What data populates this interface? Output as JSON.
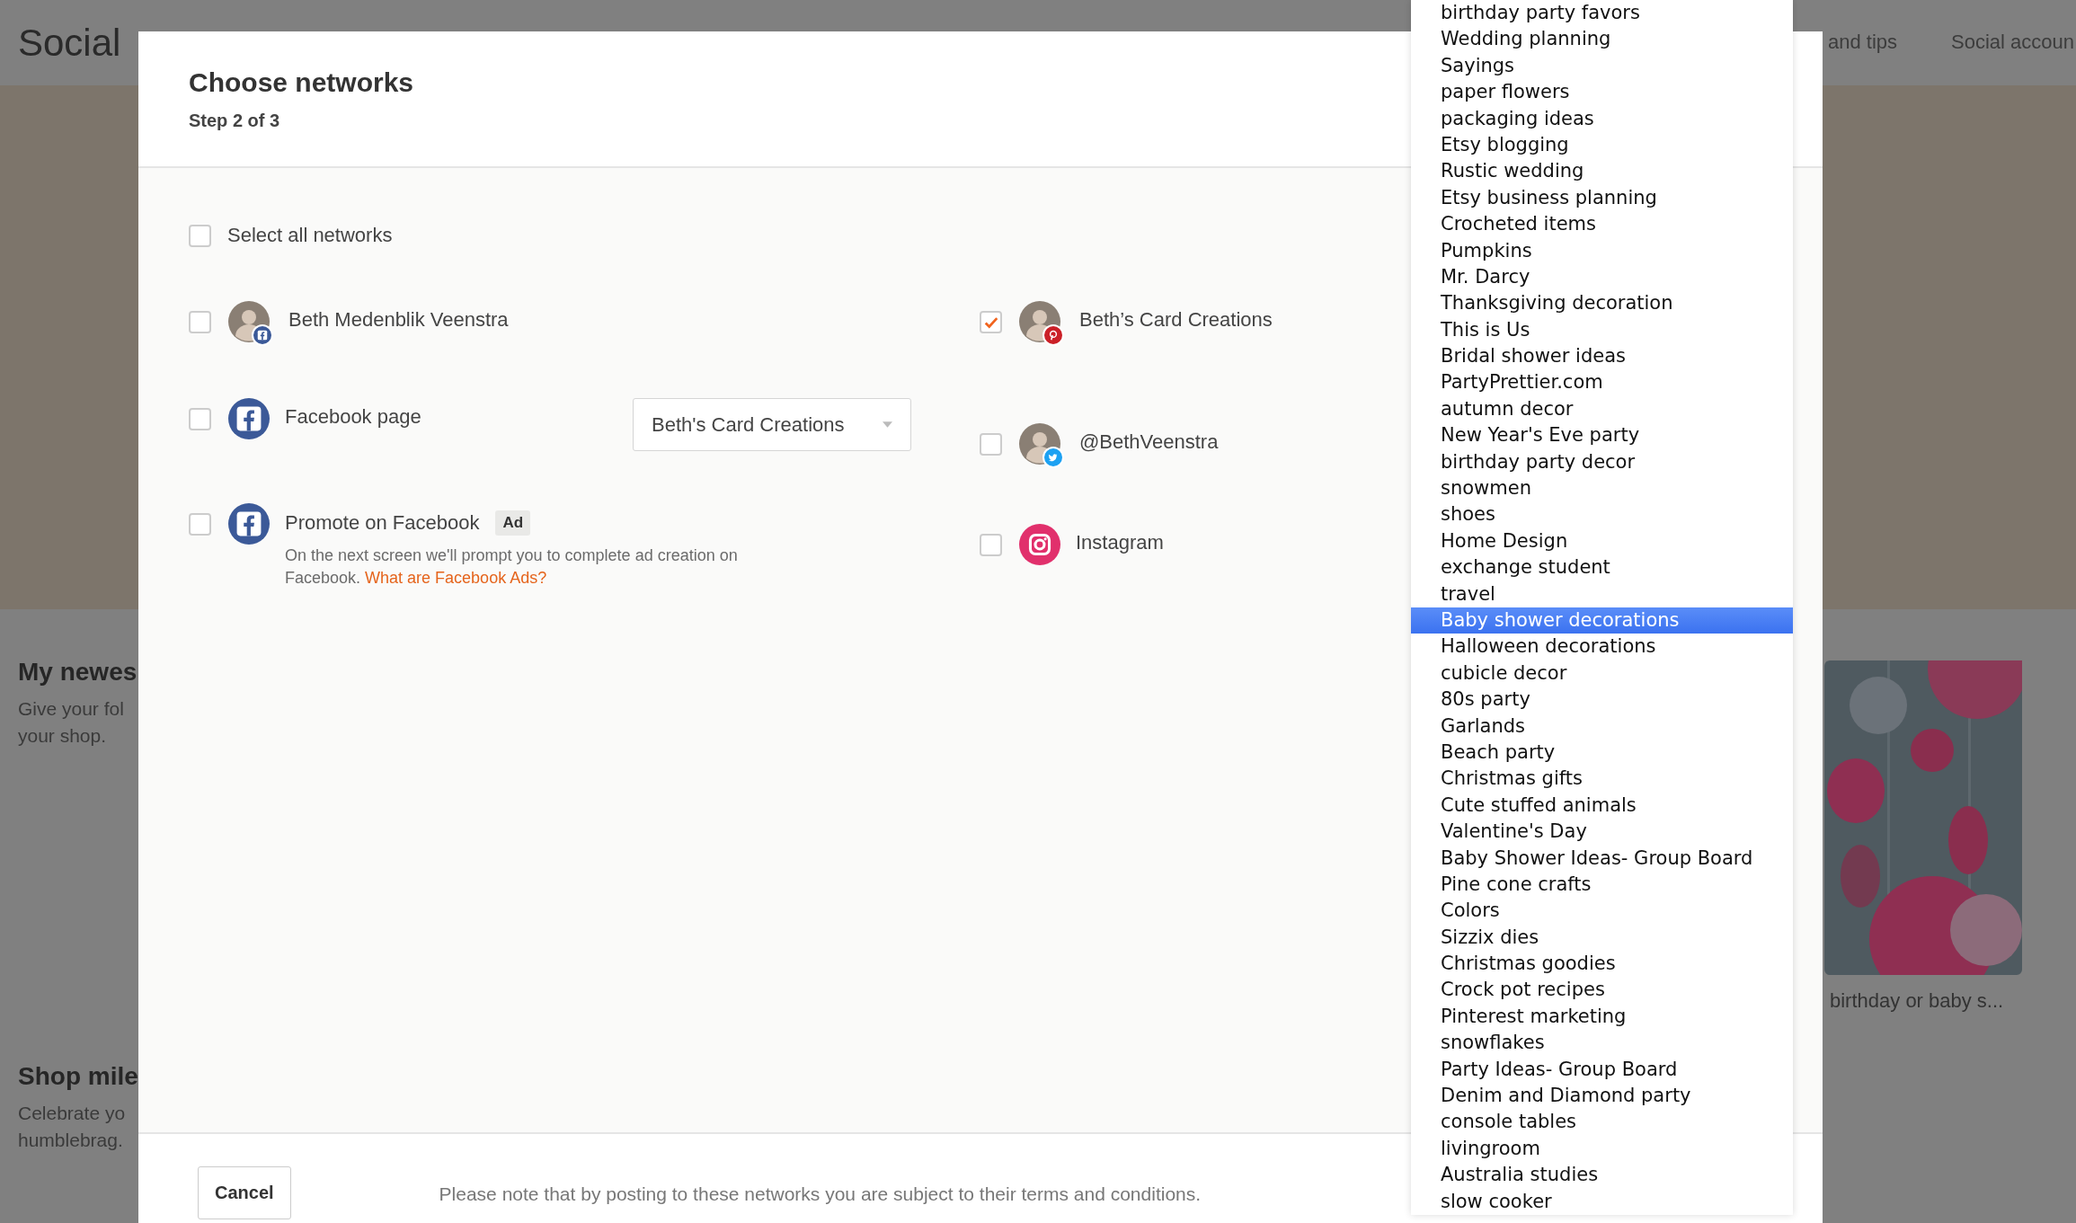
{
  "page": {
    "title": "Social",
    "nav": [
      {
        "label": "and tips"
      },
      {
        "label": "Social accoun"
      }
    ],
    "sections": [
      {
        "title": "My newes",
        "lines": [
          "Give your fol",
          "your shop."
        ]
      },
      {
        "title": "Shop mile",
        "lines": [
          "Celebrate yo",
          "humblebrag."
        ]
      }
    ],
    "card_caption": "birthday or baby s..."
  },
  "modal": {
    "title": "Choose networks",
    "step": "Step 2 of 3",
    "select_all": {
      "label": "Select all networks",
      "checked": false
    },
    "networks_left": [
      {
        "kind": "facebook",
        "avatar": true,
        "name": "Beth Medenblik Veenstra",
        "checked": false
      },
      {
        "kind": "facebook",
        "avatar": false,
        "name": "Facebook page",
        "checked": false,
        "dropdown": "Beth's Card Creations"
      },
      {
        "kind": "facebook",
        "avatar": false,
        "name": "Promote on Facebook",
        "checked": false,
        "badge": "Ad",
        "note": "On the next screen we'll prompt you to complete ad creation on Facebook.",
        "link": "What are Facebook Ads?"
      }
    ],
    "networks_right": [
      {
        "kind": "pinterest",
        "avatar": true,
        "name": "Beth’s Card Creations",
        "checked": true
      },
      {
        "kind": "twitter",
        "avatar": true,
        "name": "@BethVeenstra",
        "checked": false
      },
      {
        "kind": "instagram",
        "avatar": false,
        "name": "Instagram",
        "checked": false
      }
    ],
    "footer": {
      "cancel": "Cancel",
      "note": "Please note that by posting to these networks you are subject to their terms and conditions."
    }
  },
  "board_list": {
    "items": [
      {
        "label": "birthday party favors",
        "selected": false
      },
      {
        "label": "Wedding planning",
        "selected": false
      },
      {
        "label": "Sayings",
        "selected": false
      },
      {
        "label": "paper flowers",
        "selected": false
      },
      {
        "label": "packaging ideas",
        "selected": false
      },
      {
        "label": "Etsy blogging",
        "selected": false
      },
      {
        "label": "Rustic wedding",
        "selected": false
      },
      {
        "label": "Etsy business planning",
        "selected": false
      },
      {
        "label": "Crocheted items",
        "selected": false
      },
      {
        "label": "Pumpkins",
        "selected": false
      },
      {
        "label": "Mr. Darcy",
        "selected": false
      },
      {
        "label": "Thanksgiving decoration",
        "selected": false
      },
      {
        "label": "This is Us",
        "selected": false
      },
      {
        "label": "Bridal shower ideas",
        "selected": false
      },
      {
        "label": "PartyPrettier.com",
        "selected": false
      },
      {
        "label": "autumn decor",
        "selected": false
      },
      {
        "label": "New Year's Eve party",
        "selected": false
      },
      {
        "label": "birthday party decor",
        "selected": false
      },
      {
        "label": "snowmen",
        "selected": false
      },
      {
        "label": "shoes",
        "selected": false
      },
      {
        "label": "Home Design",
        "selected": false
      },
      {
        "label": "exchange student",
        "selected": false
      },
      {
        "label": "travel",
        "selected": false
      },
      {
        "label": "Baby shower decorations",
        "selected": true
      },
      {
        "label": "Halloween decorations",
        "selected": false
      },
      {
        "label": "cubicle decor",
        "selected": false
      },
      {
        "label": "80s party",
        "selected": false
      },
      {
        "label": "Garlands",
        "selected": false
      },
      {
        "label": "Beach party",
        "selected": false
      },
      {
        "label": "Christmas gifts",
        "selected": false
      },
      {
        "label": "Cute stuffed animals",
        "selected": false
      },
      {
        "label": "Valentine's Day",
        "selected": false
      },
      {
        "label": "Baby Shower Ideas- Group Board",
        "selected": false
      },
      {
        "label": "Pine cone crafts",
        "selected": false
      },
      {
        "label": "Colors",
        "selected": false
      },
      {
        "label": "Sizzix dies",
        "selected": false
      },
      {
        "label": "Christmas goodies",
        "selected": false
      },
      {
        "label": "Crock pot recipes",
        "selected": false
      },
      {
        "label": "Pinterest marketing",
        "selected": false
      },
      {
        "label": "snowflakes",
        "selected": false
      },
      {
        "label": "Party Ideas- Group Board",
        "selected": false
      },
      {
        "label": "Denim and Diamond party",
        "selected": false
      },
      {
        "label": "console tables",
        "selected": false
      },
      {
        "label": "livingroom",
        "selected": false
      },
      {
        "label": "Australia studies",
        "selected": false
      },
      {
        "label": "slow cooker",
        "selected": false
      }
    ]
  }
}
